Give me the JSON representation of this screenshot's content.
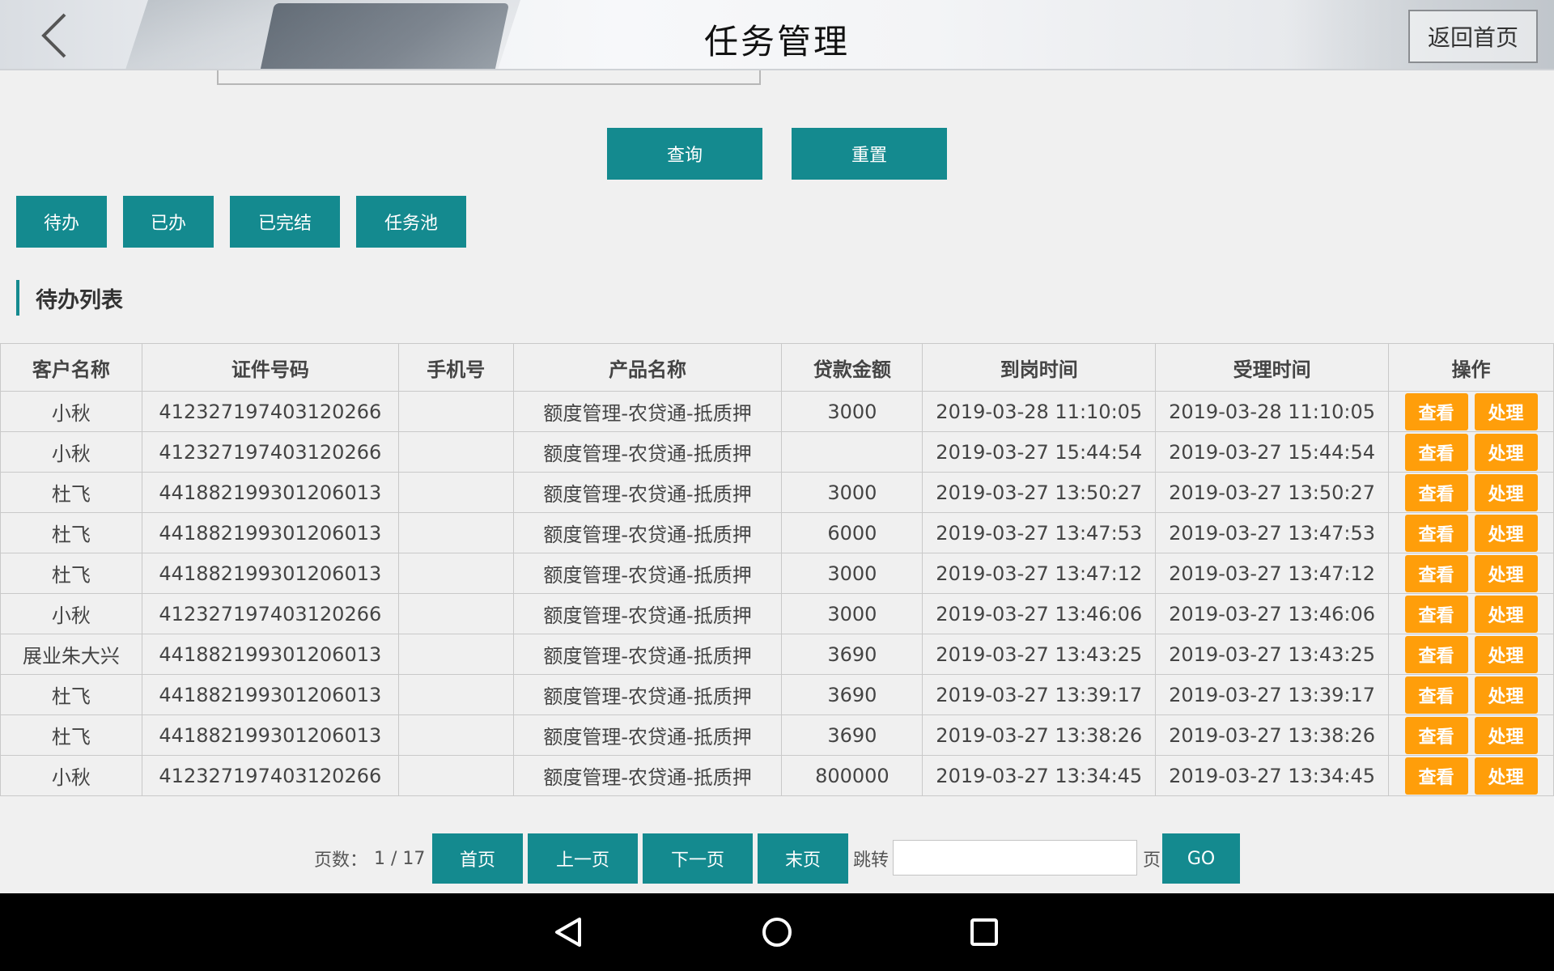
{
  "header": {
    "title": "任务管理",
    "home_label": "返回首页"
  },
  "search": {
    "query_label": "查询",
    "reset_label": "重置"
  },
  "tabs": [
    {
      "label": "待办"
    },
    {
      "label": "已办"
    },
    {
      "label": "已完结"
    },
    {
      "label": "任务池"
    }
  ],
  "section": {
    "title": "待办列表"
  },
  "table": {
    "headers": [
      "客户名称",
      "证件号码",
      "手机号",
      "产品名称",
      "贷款金额",
      "到岗时间",
      "受理时间",
      "操作"
    ],
    "view_label": "查看",
    "handle_label": "处理",
    "rows": [
      {
        "name": "小秋",
        "id": "412327197403120266",
        "phone": "",
        "product": "额度管理-农贷通-抵质押",
        "amount": "3000",
        "arrive": "2019-03-28 11:10:05",
        "accept": "2019-03-28 11:10:05"
      },
      {
        "name": "小秋",
        "id": "412327197403120266",
        "phone": "",
        "product": "额度管理-农贷通-抵质押",
        "amount": "",
        "arrive": "2019-03-27 15:44:54",
        "accept": "2019-03-27 15:44:54"
      },
      {
        "name": "杜飞",
        "id": "441882199301206013",
        "phone": "",
        "product": "额度管理-农贷通-抵质押",
        "amount": "3000",
        "arrive": "2019-03-27 13:50:27",
        "accept": "2019-03-27 13:50:27"
      },
      {
        "name": "杜飞",
        "id": "441882199301206013",
        "phone": "",
        "product": "额度管理-农贷通-抵质押",
        "amount": "6000",
        "arrive": "2019-03-27 13:47:53",
        "accept": "2019-03-27 13:47:53"
      },
      {
        "name": "杜飞",
        "id": "441882199301206013",
        "phone": "",
        "product": "额度管理-农贷通-抵质押",
        "amount": "3000",
        "arrive": "2019-03-27 13:47:12",
        "accept": "2019-03-27 13:47:12"
      },
      {
        "name": "小秋",
        "id": "412327197403120266",
        "phone": "",
        "product": "额度管理-农贷通-抵质押",
        "amount": "3000",
        "arrive": "2019-03-27 13:46:06",
        "accept": "2019-03-27 13:46:06"
      },
      {
        "name": "展业朱大兴",
        "id": "441882199301206013",
        "phone": "",
        "product": "额度管理-农贷通-抵质押",
        "amount": "3690",
        "arrive": "2019-03-27 13:43:25",
        "accept": "2019-03-27 13:43:25"
      },
      {
        "name": "杜飞",
        "id": "441882199301206013",
        "phone": "",
        "product": "额度管理-农贷通-抵质押",
        "amount": "3690",
        "arrive": "2019-03-27 13:39:17",
        "accept": "2019-03-27 13:39:17"
      },
      {
        "name": "杜飞",
        "id": "441882199301206013",
        "phone": "",
        "product": "额度管理-农贷通-抵质押",
        "amount": "3690",
        "arrive": "2019-03-27 13:38:26",
        "accept": "2019-03-27 13:38:26"
      },
      {
        "name": "小秋",
        "id": "412327197403120266",
        "phone": "",
        "product": "额度管理-农贷通-抵质押",
        "amount": "800000",
        "arrive": "2019-03-27 13:34:45",
        "accept": "2019-03-27 13:34:45"
      }
    ]
  },
  "pagination": {
    "page_label": "页数：",
    "page_info": "1 / 17",
    "first_label": "首页",
    "prev_label": "上一页",
    "next_label": "下一页",
    "last_label": "末页",
    "jump_label": "跳转",
    "page_suffix": "页",
    "go_label": "GO",
    "jump_value": ""
  },
  "colors": {
    "accent": "#148a8f",
    "action": "#ff9e0a"
  },
  "icons": {
    "back": "back-chevron-icon",
    "nav_back": "nav-back-icon",
    "nav_home": "nav-home-icon",
    "nav_recents": "nav-recents-icon"
  }
}
